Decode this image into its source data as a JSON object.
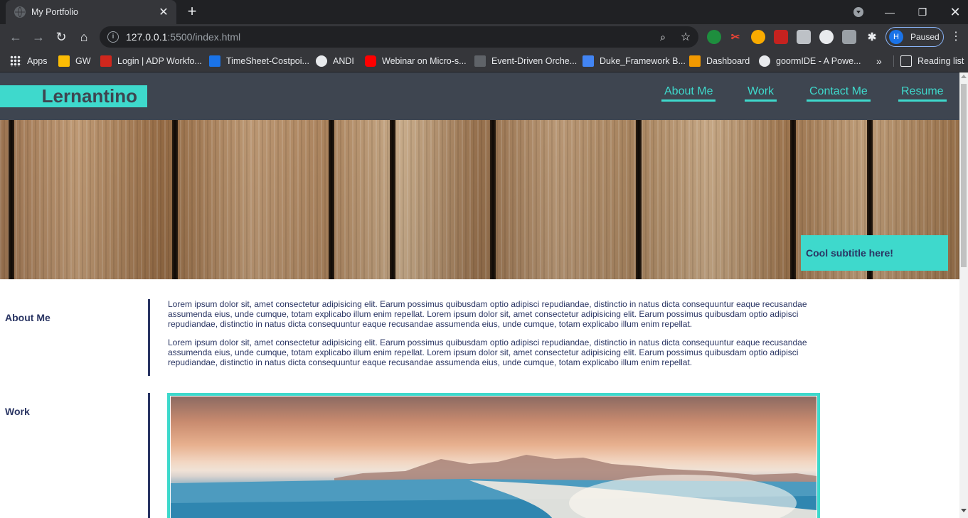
{
  "browser": {
    "tab_title": "My Portfolio",
    "tab_close": "✕",
    "new_tab": "+",
    "window_controls": {
      "minimize": "—",
      "restore": "❐",
      "close": "✕"
    },
    "url_host": "127.0.0.1",
    "url_rest": ":5500/index.html",
    "profile_initial": "H",
    "profile_status": "Paused",
    "extensions": [
      "green-dot-extension",
      "red-tool-extension",
      "owl-extension",
      "pdf-extension",
      "pages-extension",
      "circle-extension",
      "photo-extension",
      "puzzle-icon"
    ],
    "bookmarks": [
      {
        "label": "Apps",
        "icon": "apps-grid-icon"
      },
      {
        "label": "GW",
        "icon": "folder-icon"
      },
      {
        "label": "Login | ADP Workfo...",
        "icon": "adp-icon"
      },
      {
        "label": "TimeSheet-Costpoi...",
        "icon": "chevron-logo-icon"
      },
      {
        "label": "ANDI",
        "icon": "globe-icon"
      },
      {
        "label": "Webinar on Micro-s...",
        "icon": "youtube-icon"
      },
      {
        "label": "Event-Driven Orche...",
        "icon": "hexagon-icon"
      },
      {
        "label": "Duke_Framework B...",
        "icon": "board-icon"
      },
      {
        "label": "Dashboard",
        "icon": "dashboard-icon"
      },
      {
        "label": "goormIDE - A Powe...",
        "icon": "person-icon"
      }
    ],
    "bookmarks_overflow": "»",
    "reading_list": "Reading list"
  },
  "site": {
    "brand": "Lernantino",
    "nav": [
      "About Me",
      "Work",
      "Contact Me",
      "Resume"
    ],
    "hero_subtitle": "Cool subtitle here!",
    "sections": {
      "about": {
        "label": "About Me",
        "paragraphs": [
          "Lorem ipsum dolor sit, amet consectetur adipisicing elit. Earum possimus quibusdam optio adipisci repudiandae, distinctio in natus dicta consequuntur eaque recusandae assumenda eius, unde cumque, totam explicabo illum enim repellat. Lorem ipsum dolor sit, amet consectetur adipisicing elit. Earum possimus quibusdam optio adipisci repudiandae, distinctio in natus dicta consequuntur eaque recusandae assumenda eius, unde cumque, totam explicabo illum enim repellat.",
          "Lorem ipsum dolor sit, amet consectetur adipisicing elit. Earum possimus quibusdam optio adipisci repudiandae, distinctio in natus dicta consequuntur eaque recusandae assumenda eius, unde cumque, totam explicabo illum enim repellat. Lorem ipsum dolor sit, amet consectetur adipisicing elit. Earum possimus quibusdam optio adipisci repudiandae, distinctio in natus dicta consequuntur eaque recusandae assumenda eius, unde cumque, totam explicabo illum enim repellat."
        ]
      },
      "work": {
        "label": "Work"
      }
    }
  },
  "colors": {
    "accent": "#3ed9cc",
    "header_bg": "#3e4550",
    "text": "#2a3563",
    "chrome_dark": "#202124",
    "chrome_mid": "#35363a"
  }
}
